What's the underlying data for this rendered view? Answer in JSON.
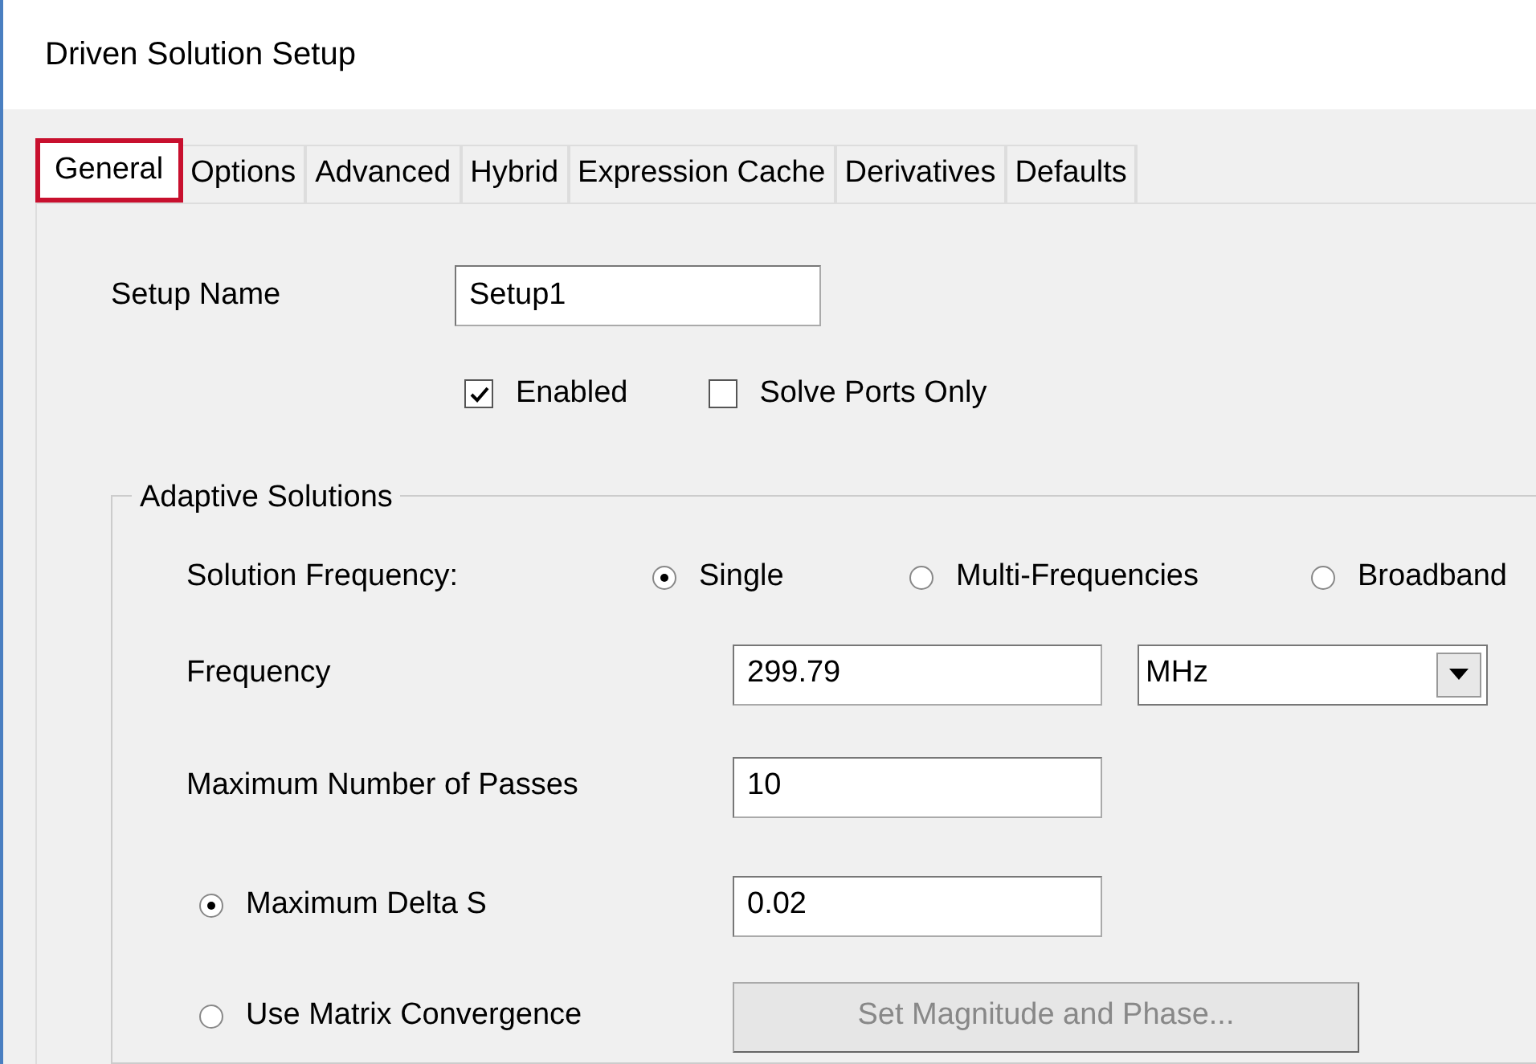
{
  "window": {
    "title": "Driven Solution Setup"
  },
  "tabs": [
    {
      "label": "General",
      "selected": true
    },
    {
      "label": "Options",
      "selected": false
    },
    {
      "label": "Advanced",
      "selected": false
    },
    {
      "label": "Hybrid",
      "selected": false
    },
    {
      "label": "Expression Cache",
      "selected": false
    },
    {
      "label": "Derivatives",
      "selected": false
    },
    {
      "label": "Defaults",
      "selected": false
    }
  ],
  "setup_name": {
    "label": "Setup Name",
    "value": "Setup1"
  },
  "checkboxes": [
    {
      "label": "Enabled",
      "checked": true
    },
    {
      "label": "Solve Ports Only",
      "checked": false
    }
  ],
  "adaptive_solutions": {
    "title": "Adaptive Solutions",
    "solution_frequency": {
      "label": "Solution Frequency:",
      "options": [
        {
          "label": "Single",
          "selected": true
        },
        {
          "label": "Multi-Frequencies",
          "selected": false
        },
        {
          "label": "Broadband",
          "selected": false
        }
      ]
    },
    "frequency": {
      "label": "Frequency",
      "value": "299.79",
      "unit": "MHz"
    },
    "max_passes": {
      "label": "Maximum Number of Passes",
      "value": "10"
    },
    "convergence": [
      {
        "label": "Maximum Delta S",
        "selected": true,
        "value": "0.02"
      },
      {
        "label": "Use Matrix Convergence",
        "selected": false,
        "button": {
          "label": "Set Magnitude and Phase...",
          "disabled": true
        }
      }
    ]
  }
}
